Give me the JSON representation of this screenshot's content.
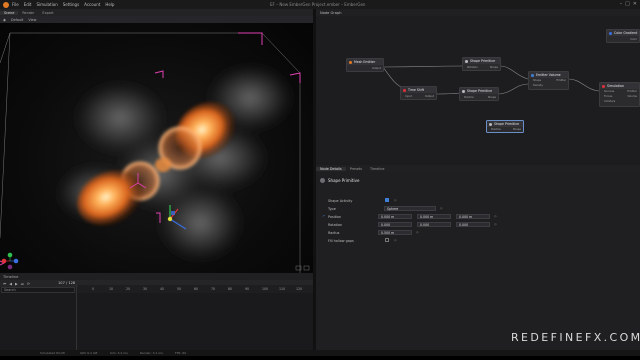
{
  "menubar": {
    "items": [
      "File",
      "Edit",
      "Simulation",
      "Settings",
      "Account",
      "Help"
    ],
    "window_title": "EF – New EmberGen Project.ember – EmberGen",
    "controls": [
      "–",
      "□",
      "✕"
    ]
  },
  "viewport": {
    "tabs": [
      "Scene",
      "Render",
      "Export"
    ],
    "toolbar": [
      "Default",
      "View"
    ]
  },
  "timeline": {
    "title": "Timeline",
    "controls": [
      "⏮",
      "◀",
      "▶",
      "⏭",
      "⟳"
    ],
    "frame_current": "107 / 128",
    "frame_end": "128",
    "search_placeholder": "Search",
    "ticks": [
      "0",
      "10",
      "20",
      "30",
      "40",
      "50",
      "60",
      "70",
      "80",
      "90",
      "100",
      "110",
      "120"
    ]
  },
  "node_graph": {
    "title": "Node Graph",
    "nodes": {
      "mesh_emitter": {
        "title": "Mesh Emitter",
        "out": "Output"
      },
      "time_shift": {
        "title": "Time Shift",
        "in": "Input",
        "out": "Output"
      },
      "shape_prim_top": {
        "title": "Shape Primitive",
        "in": "Rotation",
        "out": "Shape"
      },
      "shape_prim_mid": {
        "title": "Shape Primitive",
        "in": "Position",
        "out": "Shape"
      },
      "shape_prim_sel": {
        "title": "Shape Primitive",
        "in": "Position",
        "out": "Shape"
      },
      "emitter_volume": {
        "title": "Emitter Volume",
        "in1": "Shape",
        "in2": "Density",
        "out": "Emitter"
      },
      "simulation": {
        "title": "Simulation",
        "in1": "Sources",
        "in2": "Forces",
        "in3": "Colliders",
        "out1": "Emitter",
        "out2": "Volume"
      },
      "color_gradient": {
        "title": "Color Gradient",
        "out": "Color"
      }
    }
  },
  "properties": {
    "tabs": [
      "Node Details",
      "Presets",
      "Timeline"
    ],
    "header_title": "Shape Primitive",
    "rows": {
      "shape_activity": {
        "label": "Shape Activity"
      },
      "type": {
        "label": "Type",
        "value": "Sphere"
      },
      "position": {
        "label": "Position",
        "x": "0.000 m",
        "y": "0.000 m",
        "z": "0.000 m"
      },
      "rotation": {
        "label": "Rotation",
        "x": "0.000",
        "y": "0.000",
        "z": "0.000"
      },
      "radius": {
        "label": "Radius",
        "value": "0.500 m"
      },
      "fill": {
        "label": "Fill hollow gaps"
      }
    }
  },
  "statusbar": {
    "items": [
      "Simulated 8/128",
      "GPU 6.2 GB",
      "Sim: 5.2 ms",
      "Render: 3.1 ms",
      "FPS: 60"
    ]
  },
  "watermark": "REDEFINEFX.COM",
  "colors": {
    "accent": "#3f7fd6",
    "fire": "#e07a26",
    "gizmo_x": "#e0303a",
    "gizmo_y": "#30c050",
    "gizmo_z": "#3a6fe0",
    "bbox": "#e040b0"
  }
}
